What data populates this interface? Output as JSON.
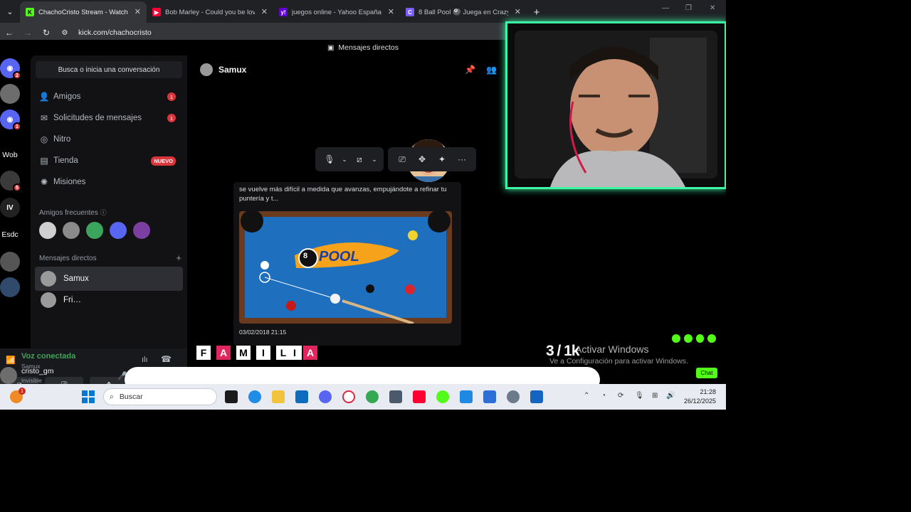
{
  "browser": {
    "tabs": [
      {
        "title": "ChachoCristo Stream - Watch L",
        "favicon": "K",
        "favicon_color": "#53fc18",
        "active": true
      },
      {
        "title": "Bob Marley - Could you be love",
        "favicon": "▶",
        "favicon_color": "#ff0033",
        "active": false
      },
      {
        "title": "juegos online - Yahoo España R",
        "favicon": "y!",
        "favicon_color": "#6001d2",
        "active": false
      },
      {
        "title": "8 Ball Pool 🎱 Juega en CrazyG",
        "favicon": "C",
        "favicon_color": "#7b5cff",
        "active": false
      }
    ],
    "new_tab": "+",
    "url": "kick.com/chachocristo"
  },
  "discord": {
    "top_title": "Mensajes directos",
    "servers": [
      {
        "label": "",
        "badge": "2",
        "color": "#5865f2"
      },
      {
        "label": "",
        "badge": "",
        "color": "#6d6d6d"
      },
      {
        "label": "",
        "badge": "1",
        "color": "#5865f2"
      },
      {
        "label": "Wob",
        "badge": "",
        "color": "#000"
      },
      {
        "label": "",
        "badge": "5",
        "color": "#3a3a3a"
      },
      {
        "label": "IV",
        "badge": "",
        "color": "#222"
      },
      {
        "label": "Esdc",
        "badge": "",
        "color": "#000"
      },
      {
        "label": "",
        "badge": "",
        "color": "#555"
      },
      {
        "label": "",
        "badge": "",
        "color": "#2f4a6a"
      }
    ],
    "search_placeholder": "Busca o inicia una conversación",
    "nav": [
      {
        "label": "Amigos",
        "icon": "friends-icon",
        "count": "1"
      },
      {
        "label": "Solicitudes de mensajes",
        "icon": "mail-icon",
        "count": "1"
      },
      {
        "label": "Nitro",
        "icon": "nitro-icon",
        "count": ""
      },
      {
        "label": "Tienda",
        "icon": "shop-icon",
        "tag": "NUEVO"
      },
      {
        "label": "Misiones",
        "icon": "quests-icon",
        "count": ""
      }
    ],
    "frequent_label": "Amigos frecuentes",
    "dm_label": "Mensajes directos",
    "dm_add": "+",
    "dms": [
      {
        "name": "Samux",
        "selected": true
      },
      {
        "name": "Fri…",
        "selected": false
      }
    ],
    "voice": {
      "status": "Voz conectada",
      "channel": "Samux"
    },
    "user": {
      "name": "cristo_gm",
      "status": "Invisible"
    },
    "chat": {
      "header": "Samux",
      "message_preview": "se vuelve más difícil a medida que avanzas, empujándote a refinar tu puntería y t...",
      "embed_timestamp": "03/02/2018 21:15",
      "pool_logo": "POOL",
      "pool_number": "8"
    }
  },
  "stream_overlay": {
    "counter": "3 / 1k",
    "watermark_title": "Activar Windows",
    "watermark_sub": "Ve a Configuración para activar Windows.",
    "banner_letters": [
      "F",
      "A",
      "M",
      "I",
      "L",
      "I",
      "A"
    ],
    "chat_button": "Chat"
  },
  "taskbar": {
    "search_placeholder": "Buscar",
    "time": "21:28",
    "date": "26/12/2025",
    "notification_badge": "1"
  }
}
